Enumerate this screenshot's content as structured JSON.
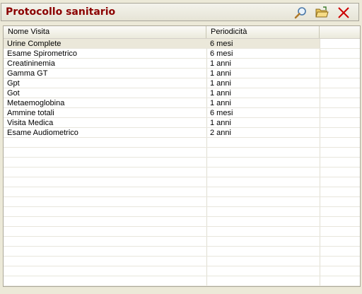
{
  "window": {
    "title": "Protocollo sanitario",
    "icons": [
      "search-icon",
      "open-folder-icon",
      "close-icon"
    ]
  },
  "table": {
    "columns": [
      "Nome Visita",
      "Periodicità"
    ],
    "rows": [
      {
        "name": "Urine Complete",
        "period": "6 mesi"
      },
      {
        "name": "Esame Spirometrico",
        "period": "6 mesi"
      },
      {
        "name": "Creatininemia",
        "period": "1 anni"
      },
      {
        "name": "Gamma GT",
        "period": "1 anni"
      },
      {
        "name": "Gpt",
        "period": "1 anni"
      },
      {
        "name": "Got",
        "period": "1 anni"
      },
      {
        "name": "Metaemoglobina",
        "period": "1 anni"
      },
      {
        "name": "Ammine totali",
        "period": "6 mesi"
      },
      {
        "name": "Visita Medica",
        "period": "1 anni"
      },
      {
        "name": "Esame Audiometrico",
        "period": "2 anni"
      }
    ],
    "selected_index": 0
  },
  "colors": {
    "title": "#8b0000",
    "close_icon": "#cc0000"
  }
}
